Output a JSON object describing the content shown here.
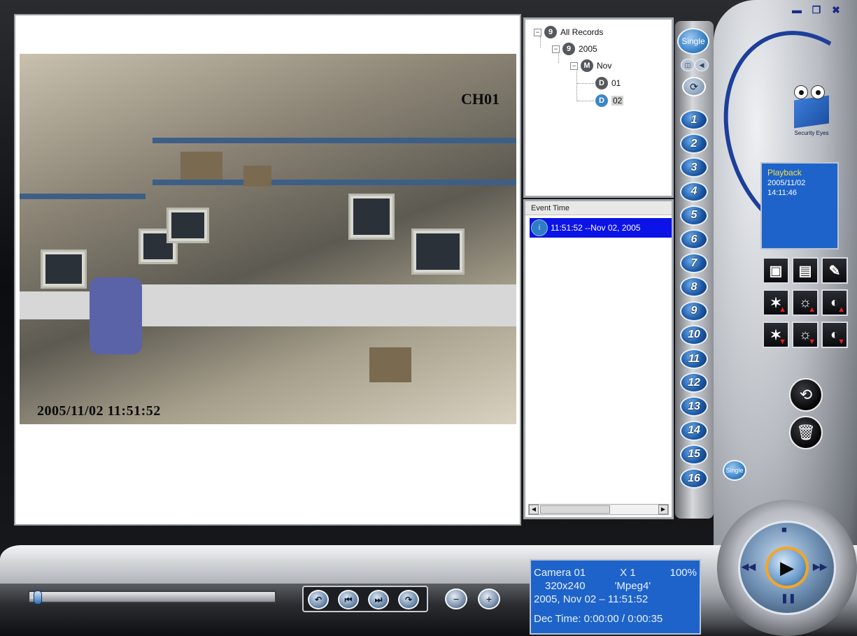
{
  "window": {
    "controls": [
      {
        "name": "minimize-icon",
        "glyph": "▬"
      },
      {
        "name": "restore-icon",
        "glyph": "❐"
      },
      {
        "name": "close-icon",
        "glyph": "✖"
      }
    ]
  },
  "video": {
    "channel_overlay": "CH01",
    "datetime_overlay": "2005/11/02 11:51:52"
  },
  "tree": {
    "root": {
      "label": "All Records",
      "icon": "9"
    },
    "year": {
      "label": "2005",
      "icon": "9"
    },
    "month": {
      "label": "Nov",
      "icon": "M"
    },
    "days": [
      {
        "label": "01",
        "icon": "D",
        "selected": false
      },
      {
        "label": "02",
        "icon": "D",
        "selected": true
      }
    ]
  },
  "events": {
    "header": "Event Time",
    "rows": [
      {
        "text": "11:51:52 --Nov 02, 2005",
        "icon": "i",
        "selected": true
      }
    ]
  },
  "channels": {
    "single_top_label": "Single",
    "mini_buttons": [
      "◫",
      "◀"
    ],
    "refresh_icon": "⟳",
    "numbers": [
      "1",
      "2",
      "3",
      "4",
      "5",
      "6",
      "7",
      "8",
      "9",
      "10",
      "11",
      "12",
      "13",
      "14",
      "15",
      "16"
    ],
    "single_bottom_label": "Single"
  },
  "logo": {
    "text": "Security Eyes"
  },
  "status": {
    "mode": "Playback",
    "date": "2005/11/02",
    "time": "14:11:46"
  },
  "tools": [
    {
      "name": "save-snapshot-icon",
      "glyph": "▣",
      "arrow": ""
    },
    {
      "name": "export-video-icon",
      "glyph": "▤",
      "arrow": ""
    },
    {
      "name": "edit-pen-icon",
      "glyph": "✎",
      "arrow": ""
    },
    {
      "name": "sharpness-up-icon",
      "glyph": "✶",
      "arrow": "▲"
    },
    {
      "name": "brightness-up-icon",
      "glyph": "☼",
      "arrow": "▲"
    },
    {
      "name": "contrast-up-icon",
      "glyph": "◐",
      "arrow": "▲"
    },
    {
      "name": "sharpness-down-icon",
      "glyph": "✶",
      "arrow": "▼"
    },
    {
      "name": "brightness-down-icon",
      "glyph": "☼",
      "arrow": "▼"
    },
    {
      "name": "contrast-down-icon",
      "glyph": "◐",
      "arrow": "▼"
    }
  ],
  "round_buttons": {
    "reset_icon": "⟲",
    "delete_icon": "🗑"
  },
  "dial": {
    "play_icon": "▶",
    "stop_icon": "■",
    "pause_icon": "❚❚",
    "rewind_icon": "◀◀",
    "forward_icon": "▶▶"
  },
  "bottom": {
    "progress": 0.03,
    "transport": [
      {
        "name": "slow-backward-icon",
        "glyph": "↶"
      },
      {
        "name": "prev-frame-icon",
        "glyph": "⏮"
      },
      {
        "name": "next-frame-icon",
        "glyph": "⏭"
      },
      {
        "name": "slow-forward-icon",
        "glyph": "↷"
      }
    ],
    "zoom_out_icon": "−",
    "zoom_in_icon": "+"
  },
  "info": {
    "camera": "Camera 01",
    "speed": "X 1",
    "zoom": "100%",
    "resolution": "320x240",
    "codec": "'Mpeg4'",
    "datetime": "2005, Nov 02 – 11:51:52",
    "dec_time": "Dec Time: 0:00:00 / 0:00:35"
  },
  "colors": {
    "panel_blue": "#1e63c9",
    "selection_blue": "#0b13e6",
    "status_accent": "#f6e04a"
  }
}
